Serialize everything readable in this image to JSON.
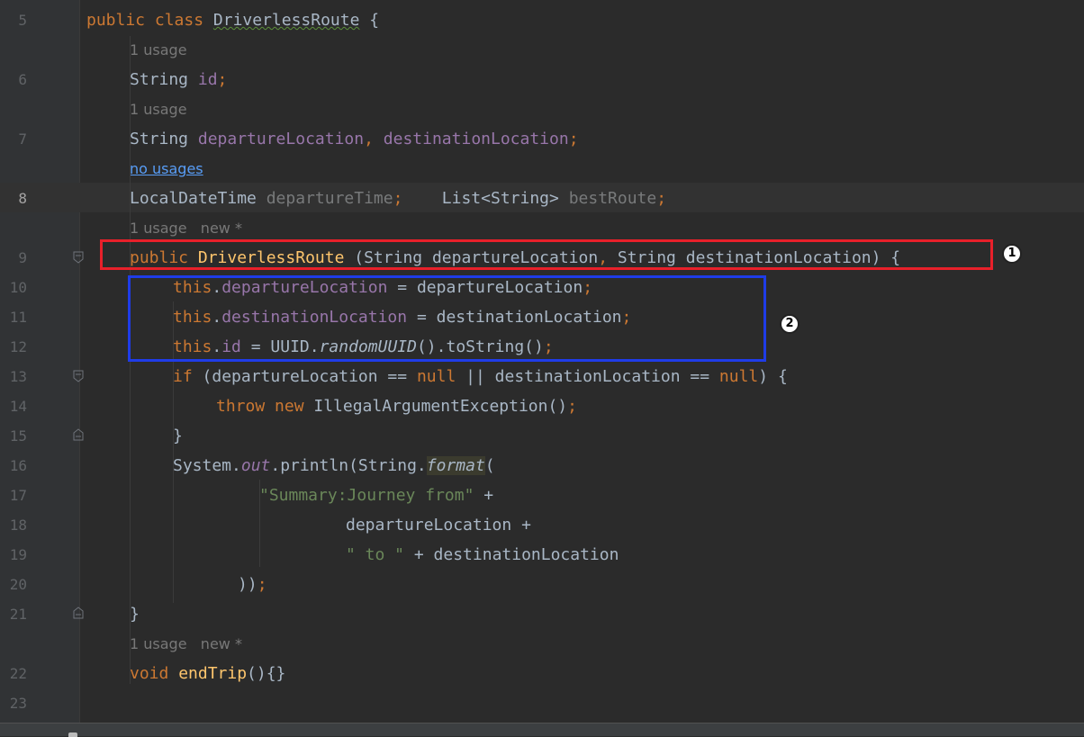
{
  "editor": {
    "lines": [
      {
        "num": "5",
        "parts": [
          [
            "kw",
            "public "
          ],
          [
            "kw",
            "class "
          ],
          [
            "plain",
            ""
          ],
          [
            "squig",
            "DriverlessRoute"
          ],
          [
            "plain",
            " {"
          ]
        ]
      },
      {
        "hint": "1 usage"
      },
      {
        "num": "6",
        "parts": [
          [
            "plain",
            "String "
          ],
          [
            "fld",
            "id"
          ],
          [
            "kw",
            ";"
          ]
        ]
      },
      {
        "hint": "1 usage"
      },
      {
        "num": "7",
        "parts": [
          [
            "plain",
            "String "
          ],
          [
            "fld",
            "departureLocation"
          ],
          [
            "kw",
            ", "
          ],
          [
            "fld",
            "destinationLocation"
          ],
          [
            "kw",
            ";"
          ]
        ]
      },
      {
        "hint_link": "no usages"
      },
      {
        "num": "8",
        "current": true,
        "parts": [
          [
            "plain",
            "LocalDateTime "
          ],
          [
            "fldg",
            "departureTime"
          ],
          [
            "kw",
            ";"
          ],
          [
            "plain",
            "    List<String> "
          ],
          [
            "fldg",
            "bestRoute"
          ],
          [
            "kw",
            ";"
          ]
        ]
      },
      {
        "hint": "1 usage   new *"
      },
      {
        "num": "9",
        "parts": [
          [
            "kw",
            "public "
          ],
          [
            "fn",
            "DriverlessRoute"
          ],
          [
            "plain",
            " (String departureLocation"
          ],
          [
            "kw",
            ","
          ],
          [
            "plain",
            " String destinationLocation) {"
          ]
        ]
      },
      {
        "num": "10",
        "parts": [
          [
            "kw",
            "this"
          ],
          [
            "plain",
            "."
          ],
          [
            "fld",
            "departureLocation"
          ],
          [
            "plain",
            " = departureLocation"
          ],
          [
            "kw",
            ";"
          ]
        ]
      },
      {
        "num": "11",
        "parts": [
          [
            "kw",
            "this"
          ],
          [
            "plain",
            "."
          ],
          [
            "fld",
            "destinationLocation"
          ],
          [
            "plain",
            " = destinationLocation"
          ],
          [
            "kw",
            ";"
          ]
        ]
      },
      {
        "num": "12",
        "parts": [
          [
            "kw",
            "this"
          ],
          [
            "plain",
            "."
          ],
          [
            "fld",
            "id"
          ],
          [
            "plain",
            " = UUID."
          ],
          [
            "it",
            "randomUUID"
          ],
          [
            "plain",
            "().toString()"
          ],
          [
            "kw",
            ";"
          ]
        ]
      },
      {
        "num": "13",
        "parts": [
          [
            "kw",
            "if "
          ],
          [
            "plain",
            "(departureLocation == "
          ],
          [
            "kw",
            "null"
          ],
          [
            "plain",
            " || destinationLocation == "
          ],
          [
            "kw",
            "null"
          ],
          [
            "plain",
            ") {"
          ]
        ]
      },
      {
        "num": "14",
        "parts": [
          [
            "kw",
            "throw new "
          ],
          [
            "plain",
            "IllegalArgumentException()"
          ],
          [
            "kw",
            ";"
          ]
        ]
      },
      {
        "num": "15",
        "parts": [
          [
            "plain",
            "}"
          ]
        ]
      },
      {
        "num": "16",
        "parts": [
          [
            "plain",
            "System."
          ],
          [
            "fldit",
            "out"
          ],
          [
            "plain",
            ".println(String."
          ],
          [
            "ithl",
            "format"
          ],
          [
            "plain",
            "("
          ]
        ]
      },
      {
        "num": "17",
        "parts": [
          [
            "str",
            "\"Summary:Journey from\""
          ],
          [
            "plain",
            " +"
          ]
        ]
      },
      {
        "num": "18",
        "parts": [
          [
            "plain",
            "departureLocation +"
          ]
        ]
      },
      {
        "num": "19",
        "parts": [
          [
            "str",
            "\" to \""
          ],
          [
            "plain",
            " + destinationLocation"
          ]
        ]
      },
      {
        "num": "20",
        "parts": [
          [
            "plain",
            "))"
          ],
          [
            "kw",
            ";"
          ]
        ]
      },
      {
        "num": "21",
        "parts": [
          [
            "plain",
            "}"
          ]
        ]
      },
      {
        "hint": "1 usage   new *"
      },
      {
        "num": "22",
        "parts": [
          [
            "kw",
            "void "
          ],
          [
            "fn",
            "endTrip"
          ],
          [
            "plain",
            "(){}"
          ]
        ]
      },
      {
        "num": "23",
        "parts": []
      }
    ]
  },
  "annotations": {
    "badge1": "1",
    "badge2": "2"
  },
  "colors": {
    "background": "#2b2b2b",
    "keyword": "#cc7832",
    "field": "#9876aa",
    "string": "#6a8759",
    "method": "#ffc66d",
    "annotation_red": "#e8202a",
    "annotation_blue": "#1f3ce8"
  }
}
